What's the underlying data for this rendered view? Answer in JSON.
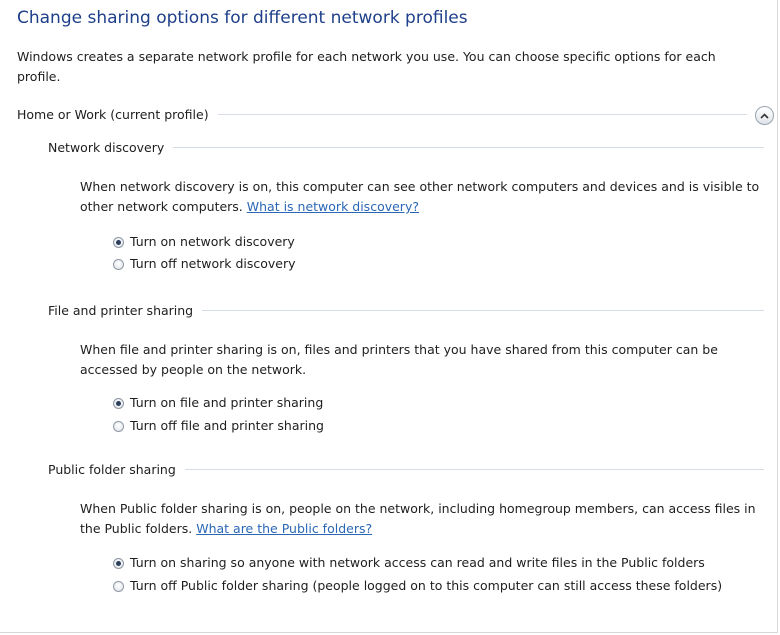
{
  "title": "Change sharing options for different network profiles",
  "intro": "Windows creates a separate network profile for each network you use. You can choose specific options for each profile.",
  "profile": {
    "label": "Home or Work (current profile)",
    "collapse_icon": "chevron-up-icon"
  },
  "network_discovery": {
    "heading": "Network discovery",
    "description": "When network discovery is on, this computer can see other network computers and devices and is visible to other network computers.",
    "link": "What is network discovery?",
    "options": [
      {
        "label": "Turn on network discovery",
        "selected": true
      },
      {
        "label": "Turn off network discovery",
        "selected": false
      }
    ]
  },
  "file_printer_sharing": {
    "heading": "File and printer sharing",
    "description": "When file and printer sharing is on, files and printers that you have shared from this computer can be accessed by people on the network.",
    "options": [
      {
        "label": "Turn on file and printer sharing",
        "selected": true
      },
      {
        "label": "Turn off file and printer sharing",
        "selected": false
      }
    ]
  },
  "public_folder_sharing": {
    "heading": "Public folder sharing",
    "description": "When Public folder sharing is on, people on the network, including homegroup members, can access files in the Public folders.",
    "link": "What are the Public folders?",
    "options": [
      {
        "label": "Turn on sharing so anyone with network access can read and write files in the Public folders",
        "selected": true
      },
      {
        "label": "Turn off Public folder sharing (people logged on to this computer can still access these folders)",
        "selected": false
      }
    ]
  }
}
